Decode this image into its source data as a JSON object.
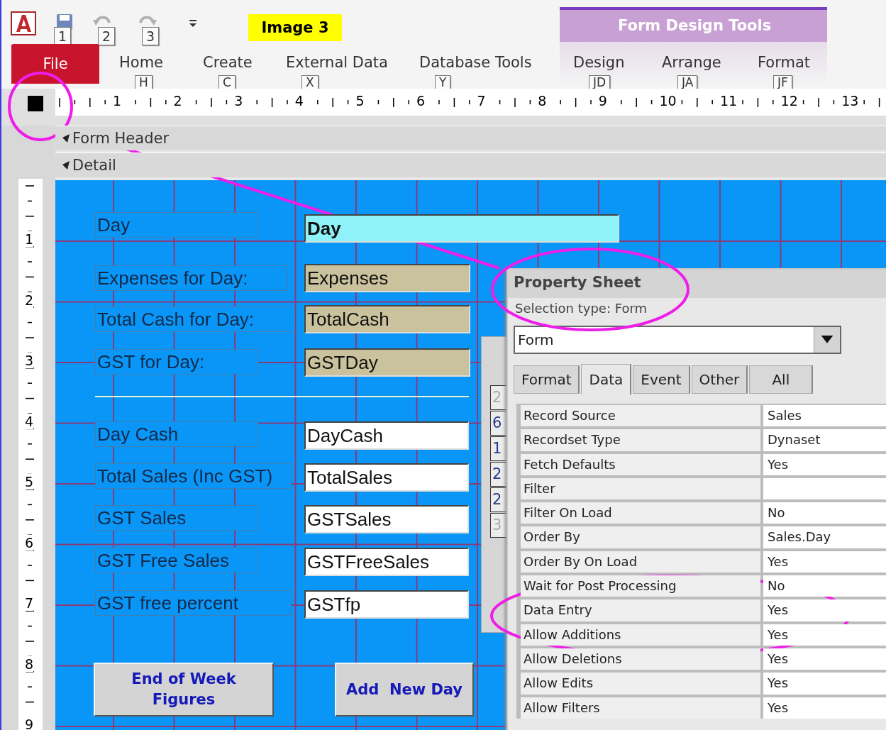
{
  "annotation_label": "Image 3",
  "quick_access": {
    "keytips": [
      "1",
      "2",
      "3"
    ]
  },
  "ribbon": {
    "contextual_group": "Form Design Tools",
    "tabs": [
      {
        "label": "File",
        "kind": "file"
      },
      {
        "label": "Home",
        "keytip": "H",
        "kind": "tab"
      },
      {
        "label": "Create",
        "keytip": "C",
        "kind": "tab"
      },
      {
        "label": "External Data",
        "keytip": "X",
        "kind": "tab"
      },
      {
        "label": "Database Tools",
        "keytip": "Y",
        "kind": "tab"
      },
      {
        "label": "Design",
        "keytip": "JD",
        "kind": "contextual"
      },
      {
        "label": "Arrange",
        "keytip": "JA",
        "kind": "contextual"
      },
      {
        "label": "Format",
        "keytip": "JF",
        "kind": "contextual"
      }
    ]
  },
  "rulers": {
    "horizontal": [
      "1",
      "2",
      "3",
      "4",
      "5",
      "6",
      "7",
      "8",
      "9",
      "10",
      "11",
      "12",
      "13"
    ],
    "vertical": [
      "1",
      "2",
      "3",
      "4",
      "5",
      "6",
      "7",
      "8",
      "9"
    ]
  },
  "sections": [
    "Form Header",
    "Detail"
  ],
  "form": {
    "fields": [
      {
        "label": "Day",
        "value": "Day",
        "kind": "key"
      },
      {
        "label": "Expenses for Day:",
        "value": "Expenses",
        "kind": "calculated"
      },
      {
        "label": "Total Cash for Day:",
        "value": "TotalCash",
        "kind": "calculated"
      },
      {
        "label": "GST for Day:",
        "value": "GSTDay",
        "kind": "calculated"
      },
      {
        "label": "Day  Cash",
        "value": "DayCash",
        "kind": "plain"
      },
      {
        "label": "Total Sales (Inc GST)",
        "value": "TotalSales",
        "kind": "plain"
      },
      {
        "label": "GST Sales",
        "value": "GSTSales",
        "kind": "plain"
      },
      {
        "label": "GST Free Sales",
        "value": "GSTFreeSales",
        "kind": "plain"
      },
      {
        "label": "GST free percent",
        "value": "GSTfp",
        "kind": "plain"
      }
    ],
    "buttons": [
      "End of Week Figures",
      "Add  New Day"
    ]
  },
  "subform": {
    "cells": [
      {
        "text": "2",
        "dimmed": true
      },
      {
        "text": "6",
        "dimmed": false
      },
      {
        "text": "1",
        "dimmed": false
      },
      {
        "text": "2",
        "dimmed": false
      },
      {
        "text": "2",
        "dimmed": false
      },
      {
        "text": "3",
        "dimmed": true
      }
    ]
  },
  "property_sheet": {
    "title": "Property Sheet",
    "selection_type": "Selection type:  Form",
    "object": "Form",
    "tabs": [
      {
        "label": "Format",
        "selected": false
      },
      {
        "label": "Data",
        "selected": true
      },
      {
        "label": "Event",
        "selected": false
      },
      {
        "label": "Other",
        "selected": false
      },
      {
        "label": "All",
        "selected": false
      }
    ],
    "properties": [
      {
        "name": "Record Source",
        "value": "Sales"
      },
      {
        "name": "Recordset Type",
        "value": "Dynaset"
      },
      {
        "name": "Fetch Defaults",
        "value": "Yes"
      },
      {
        "name": "Filter"
      },
      {
        "name": "Filter On Load",
        "value": "No"
      },
      {
        "name": "Order By",
        "value": "Sales.Day"
      },
      {
        "name": "Order By On Load",
        "value": "Yes"
      },
      {
        "name": "Wait for Post Processing",
        "value": "No"
      },
      {
        "name": "Data Entry",
        "value": "Yes"
      },
      {
        "name": "Allow Additions",
        "value": "Yes"
      },
      {
        "name": "Allow Deletions",
        "value": "Yes"
      },
      {
        "name": "Allow Edits",
        "value": "Yes"
      },
      {
        "name": "Allow Filters",
        "value": "Yes"
      }
    ]
  }
}
